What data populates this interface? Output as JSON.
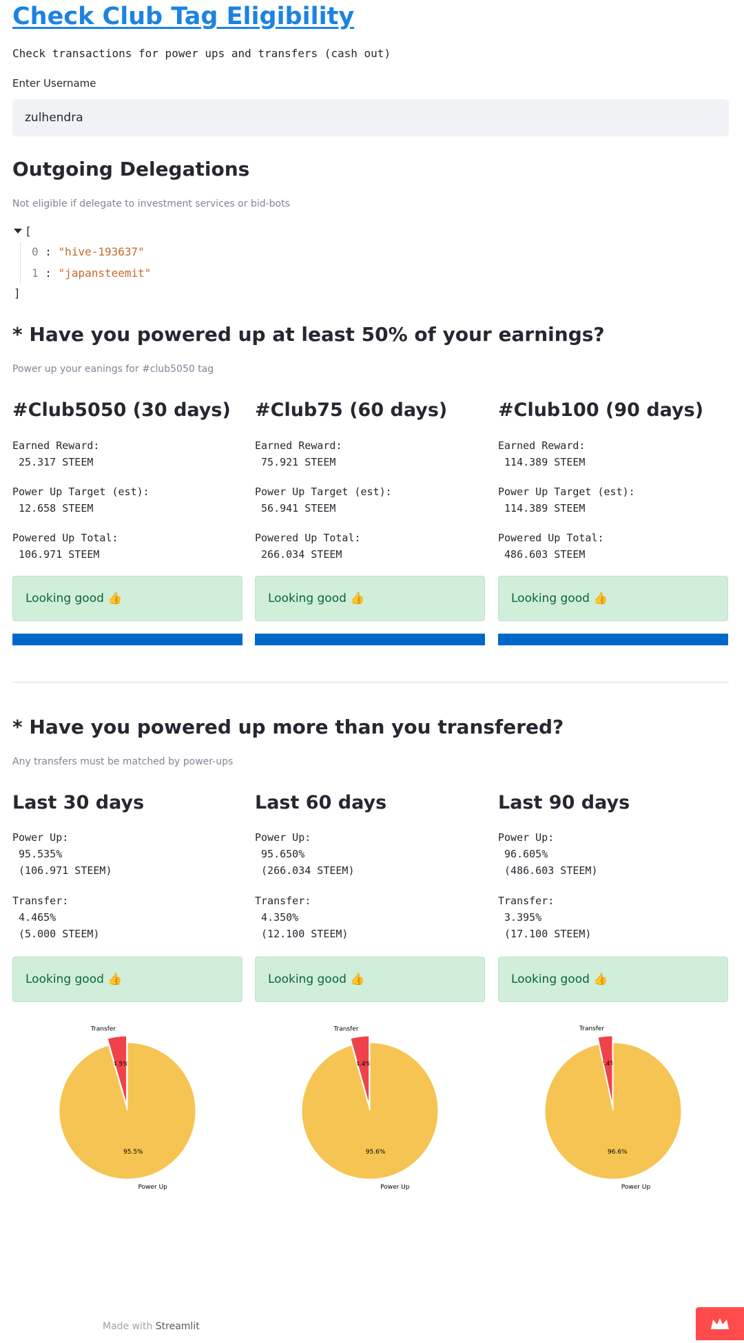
{
  "page": {
    "title": "Check Club Tag Eligibility",
    "subtitle": "Check transactions for power ups and transfers (cash out)"
  },
  "username": {
    "label": "Enter Username",
    "value": "zulhendra"
  },
  "delegations": {
    "heading": "Outgoing Delegations",
    "caption": "Not eligible if delegate to investment services or bid-bots",
    "open_bracket": "[",
    "close_bracket": "]",
    "items": [
      {
        "index": "0",
        "value": "\"hive-193637\""
      },
      {
        "index": "1",
        "value": "\"japansteemit\""
      }
    ]
  },
  "powerup_section": {
    "heading": "* Have you powered up at least 50% of your earnings?",
    "caption": "Power up your eanings for #club5050 tag",
    "columns": [
      {
        "title": "#Club5050 (30 days)",
        "earned": "Earned Reward:\n 25.317 STEEM",
        "target": "Power Up Target (est):\n 12.658 STEEM",
        "total": "Powered Up Total:\n 106.971 STEEM",
        "status": "Looking good 👍",
        "progress": 1.0
      },
      {
        "title": "#Club75 (60 days)",
        "earned": "Earned Reward:\n 75.921 STEEM",
        "target": "Power Up Target (est):\n 56.941 STEEM",
        "total": "Powered Up Total:\n 266.034 STEEM",
        "status": "Looking good 👍",
        "progress": 1.0
      },
      {
        "title": "#Club100 (90 days)",
        "earned": "Earned Reward:\n 114.389 STEEM",
        "target": "Power Up Target (est):\n 114.389 STEEM",
        "total": "Powered Up Total:\n 486.603 STEEM",
        "status": "Looking good 👍",
        "progress": 1.0
      }
    ]
  },
  "transfer_section": {
    "heading": "* Have you powered up more than you transfered?",
    "caption": "Any transfers must be matched by power-ups",
    "columns": [
      {
        "title": "Last 30 days",
        "powerup": "Power Up:\n 95.535%\n (106.971 STEEM)",
        "transfer": "Transfer:\n 4.465%\n (5.000 STEEM)",
        "status": "Looking good 👍"
      },
      {
        "title": "Last 60 days",
        "powerup": "Power Up:\n 95.650%\n (266.034 STEEM)",
        "transfer": "Transfer:\n 4.350%\n (12.100 STEEM)",
        "status": "Looking good 👍"
      },
      {
        "title": "Last 90 days",
        "powerup": "Power Up:\n 96.605%\n (486.603 STEEM)",
        "transfer": "Transfer:\n 3.395%\n (17.100 STEEM)",
        "status": "Looking good 👍"
      }
    ]
  },
  "chart_data": [
    {
      "type": "pie",
      "labels": [
        "Transfer",
        "Power Up"
      ],
      "values": [
        4.465,
        95.535
      ],
      "pct_labels": [
        "4.5%",
        "95.5%"
      ],
      "exploded": "Transfer",
      "colors": [
        "#f0424a",
        "#f6c452"
      ]
    },
    {
      "type": "pie",
      "labels": [
        "Transfer",
        "Power Up"
      ],
      "values": [
        4.35,
        95.65
      ],
      "pct_labels": [
        "4.4%",
        "95.6%"
      ],
      "exploded": "Transfer",
      "colors": [
        "#f0424a",
        "#f6c452"
      ]
    },
    {
      "type": "pie",
      "labels": [
        "Transfer",
        "Power Up"
      ],
      "values": [
        3.395,
        96.605
      ],
      "pct_labels": [
        "3.4%",
        "96.6%"
      ],
      "exploded": "Transfer",
      "colors": [
        "#f0424a",
        "#f6c452"
      ]
    }
  ],
  "footer": {
    "made_with": "Made with",
    "brand": "Streamlit"
  },
  "colors": {
    "accent": "#1c83e1",
    "progress": "#0068c9",
    "success_bg": "#d0eed9",
    "success_text": "#0b6636"
  }
}
